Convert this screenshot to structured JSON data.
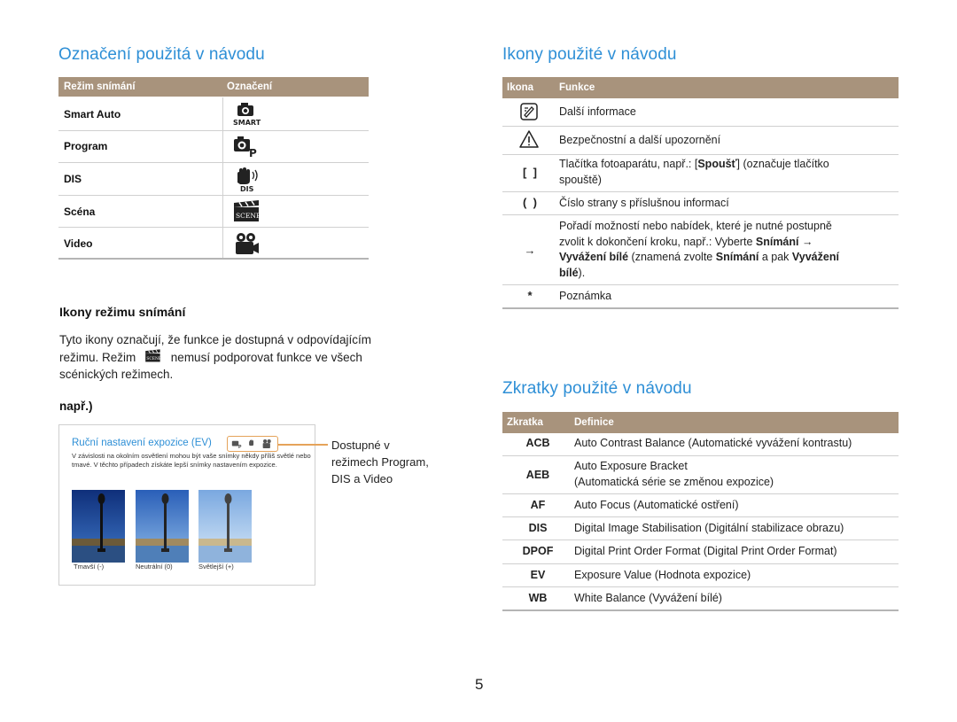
{
  "left": {
    "title": "Označení použitá v návodu",
    "table": {
      "col1": "Režim snímání",
      "col2": "Označení",
      "rows": [
        {
          "label": "Smart Auto",
          "icon": "smart-auto-icon"
        },
        {
          "label": "Program",
          "icon": "program-icon"
        },
        {
          "label": "DIS",
          "icon": "dis-icon"
        },
        {
          "label": "Scéna",
          "icon": "scene-icon"
        },
        {
          "label": "Video",
          "icon": "video-icon"
        }
      ]
    },
    "subtitle": "Ikony režimu snímání",
    "para_line1": "Tyto ikony označují, že funkce je dostupná v odpovídajícím",
    "para_line2a": "režimu. Režim",
    "para_line2b": "nemusí podporovat funkce ve všech",
    "para_line3": "scénických režimech.",
    "example_label": "např.)",
    "example": {
      "title": "Ruční nastavení expozice (EV)",
      "text": "V závislosti na okolním osvětlení mohou být vaše snímky někdy příliš světlé nebo tmavé. V těchto případech získáte lepší snímky nastavením expozice.",
      "captions": [
        "Tmavší (-)",
        "Neutrální (0)",
        "Světlejší (+)"
      ],
      "callout_lines": [
        "Dostupné v",
        "režimech Program,",
        "DIS a Video"
      ]
    }
  },
  "icons": {
    "title": "Ikony použité v návodu",
    "col1": "Ikona",
    "col2": "Funkce",
    "rows": [
      {
        "symbol": "",
        "icon": "note-icon",
        "text": "Další informace"
      },
      {
        "symbol": "",
        "icon": "warning-icon",
        "text": "Bezpečnostní a další upozornění"
      },
      {
        "symbol": "[  ]",
        "lines": [
          "Tlačítka fotoaparátu, např.: [Spoušť] (označuje tlačítko",
          "spouště)"
        ]
      },
      {
        "symbol": "(  )",
        "text": "Číslo strany s příslušnou informací"
      },
      {
        "symbol": "→",
        "lines": [
          "Pořadí možností nebo nabídek, které je nutné postupně",
          "zvolit k dokončení kroku, např.: Vyberte Snímání →",
          "Vyvážení  bílé (znamená zvolte Snímání a pak Vyvážení",
          "bílé)."
        ]
      },
      {
        "symbol": "*",
        "text": "Poznámka"
      }
    ]
  },
  "shortcuts": {
    "title": "Zkratky použité v návodu",
    "col1": "Zkratka",
    "col2": "Definice",
    "rows": [
      {
        "abbr": "ACB",
        "lines": [
          "Auto Contrast Balance (Automatické vyvážení kontrastu)"
        ]
      },
      {
        "abbr": "AEB",
        "lines": [
          "Auto Exposure Bracket",
          "(Automatická série se změnou expozice)"
        ]
      },
      {
        "abbr": "AF",
        "lines": [
          "Auto Focus (Automatické ostření)"
        ]
      },
      {
        "abbr": "DIS",
        "lines": [
          "Digital Image Stabilisation (Digitální stabilizace obrazu)"
        ]
      },
      {
        "abbr": "DPOF",
        "lines": [
          "Digital Print Order Format (Digital Print Order Format)"
        ]
      },
      {
        "abbr": "EV",
        "lines": [
          "Exposure Value (Hodnota expozice)"
        ]
      },
      {
        "abbr": "WB",
        "lines": [
          "White Balance (Vyvážení bílé)"
        ]
      }
    ]
  },
  "page_number": "5",
  "colors": {
    "heading": "#2e8fd6",
    "table_header": "#a8937c",
    "callout": "#e5a35a"
  }
}
